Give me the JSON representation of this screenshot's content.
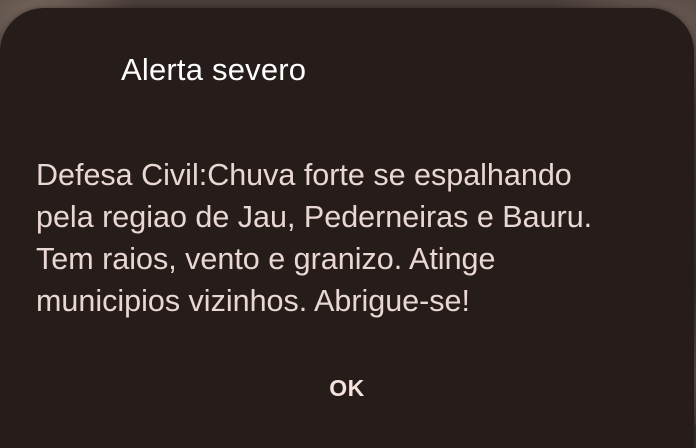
{
  "dialog": {
    "title": "Alerta severo",
    "message_lines": [
      "Defesa Civil:Chuva forte se espalhando",
      "pela regiao de Jau, Pederneiras e Bauru.",
      "Tem raios, vento e granizo. Atinge",
      "municipios vizinhos. Abrigue-se!"
    ],
    "ok_label": "OK"
  },
  "colors": {
    "dialog_background": "#261d1b",
    "title_text": "#ffffff",
    "body_text": "#e8d7d2",
    "button_text": "#f6e3dd"
  }
}
